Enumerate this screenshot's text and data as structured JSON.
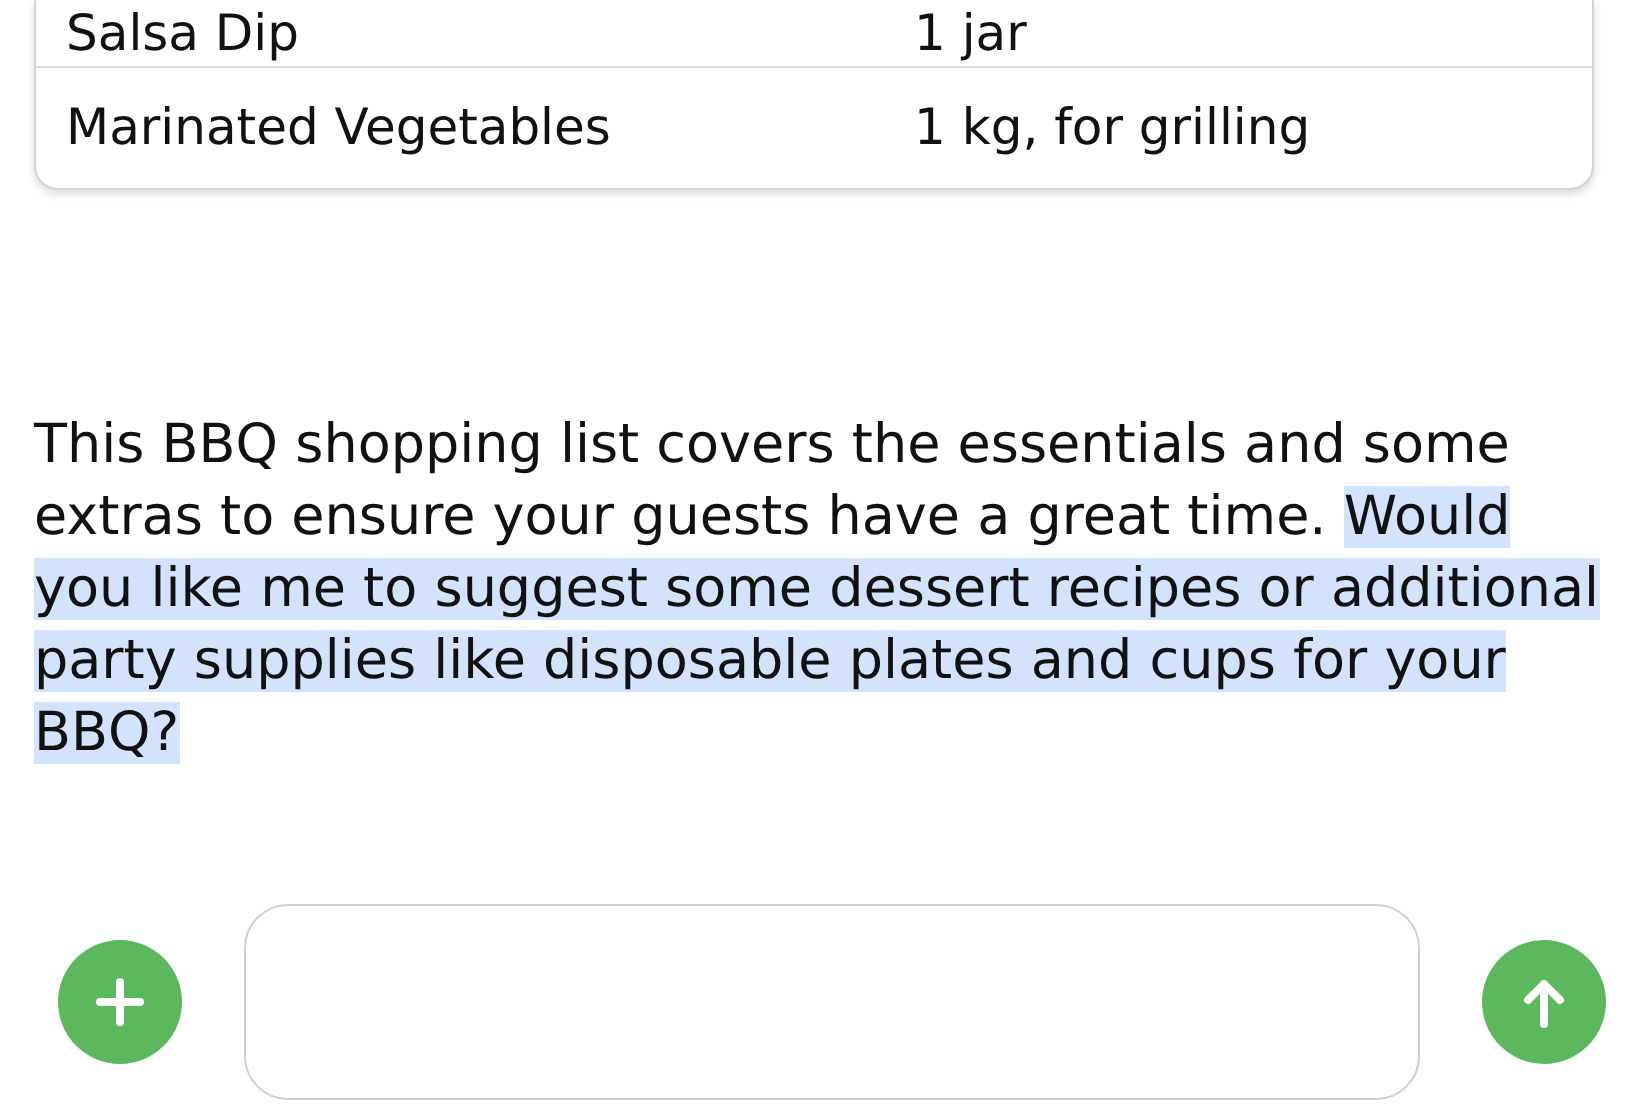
{
  "table": {
    "rows": [
      {
        "cells": [
          "Salsa Dip",
          "1 jar"
        ]
      },
      {
        "cells": [
          "Marinated Vegetables",
          "1 kg, for grilling"
        ]
      }
    ]
  },
  "message": {
    "parts": [
      {
        "text": "This BBQ shopping list covers the essentials and some extras to ensure your guests have a great time. ",
        "highlighted": false
      },
      {
        "text": "Would you like me to suggest some dessert recipes or additional party supplies like disposable plates and cups for your BBQ?",
        "highlighted": true
      }
    ]
  }
}
